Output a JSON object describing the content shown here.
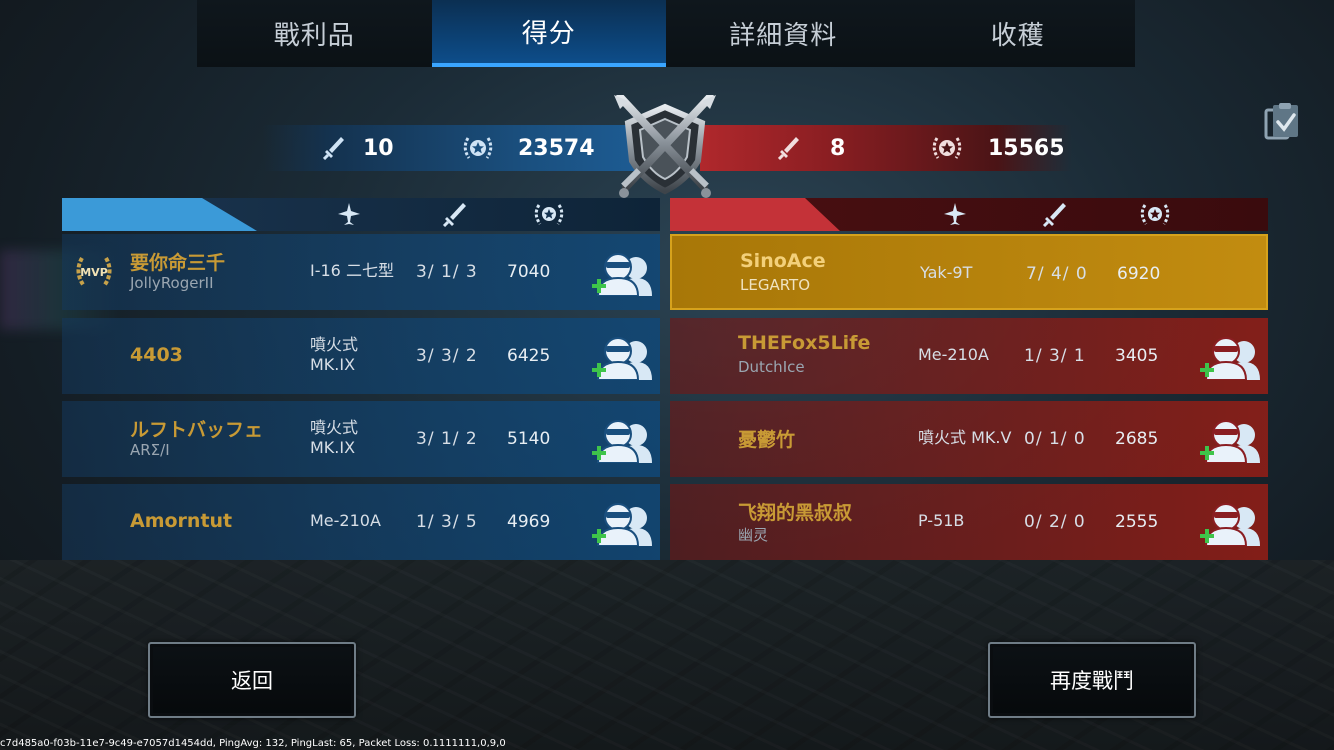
{
  "tabs": [
    {
      "label": "戰利品",
      "active": false
    },
    {
      "label": "得分",
      "active": true
    },
    {
      "label": "詳細資料",
      "active": false
    },
    {
      "label": "收穫",
      "active": false
    }
  ],
  "score": {
    "left": {
      "kills": "10",
      "points": "23574",
      "color": "#1d5b92"
    },
    "right": {
      "kills": "8",
      "points": "15565",
      "color": "#b0282c"
    }
  },
  "columns": [
    "plane-icon",
    "sword-icon",
    "laurel-star-icon"
  ],
  "blue_team": [
    {
      "name": "要你命三千",
      "sub": "JollyRogerII",
      "plane_line1": "I-16 二七型",
      "plane_line2": "",
      "kda": "3/ 1/ 3",
      "points": "7040",
      "mvp": true,
      "mvp_label": "MVP"
    },
    {
      "name": "4403",
      "sub": "",
      "plane_line1": "噴火式",
      "plane_line2": "MK.IX",
      "kda": "3/ 3/ 2",
      "points": "6425"
    },
    {
      "name": "ルフトバッフェ",
      "sub": "ARΣ/I",
      "plane_line1": "噴火式",
      "plane_line2": "MK.IX",
      "kda": "3/ 1/ 2",
      "points": "5140"
    },
    {
      "name": "Amorntut",
      "sub": "",
      "plane_line1": "Me-210A",
      "plane_line2": "",
      "kda": "1/ 3/ 5",
      "points": "4969"
    }
  ],
  "red_team": [
    {
      "name": "SinoAce",
      "sub": "LEGARTO",
      "plane_line1": "Yak-9T",
      "plane_line2": "",
      "kda": "7/ 4/ 0",
      "points": "6920",
      "highlight": true
    },
    {
      "name": "THEFox5Life",
      "sub": "DutchIce",
      "plane_line1": "Me-210A",
      "plane_line2": "",
      "kda": "1/ 3/ 1",
      "points": "3405"
    },
    {
      "name": "憂鬱竹",
      "sub": "",
      "plane_line1": "噴火式 MK.V",
      "plane_line2": "",
      "kda": "0/ 1/ 0",
      "points": "2685"
    },
    {
      "name": "飞翔的黑叔叔",
      "sub": "幽灵",
      "plane_line1": "P-51B",
      "plane_line2": "",
      "kda": "0/ 2/ 0",
      "points": "2555"
    }
  ],
  "buttons": {
    "back": "返回",
    "again": "再度戰鬥"
  },
  "debug_line": "c7d485a0-f03b-11e7-9c49-e7057d1454dd, PingAvg: 132, PingLast: 65, Packet Loss: 0.1111111,0,9,0"
}
